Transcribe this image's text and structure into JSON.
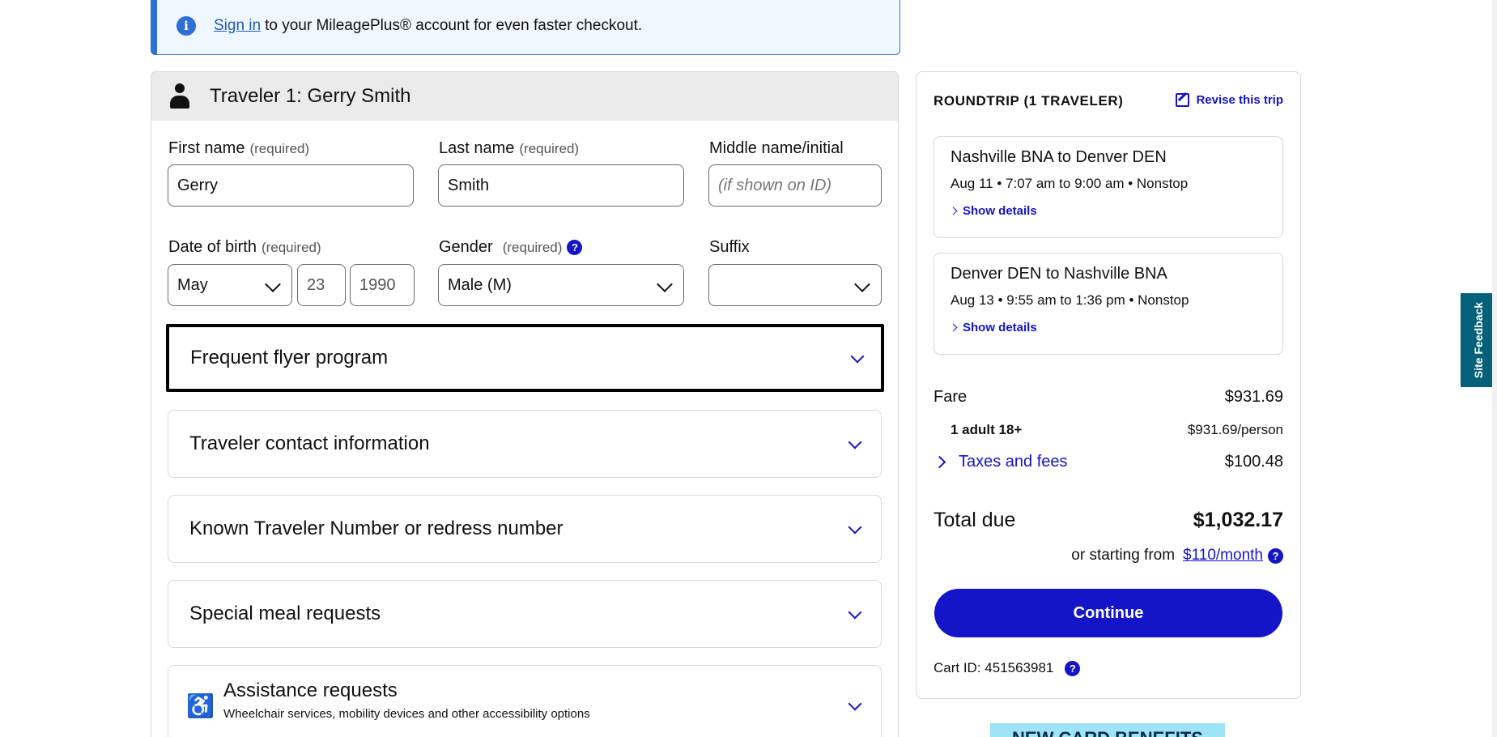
{
  "banner": {
    "info_icon": "i",
    "signin_link": "Sign in",
    "text": "to your MileagePlus® account for even faster checkout."
  },
  "traveler": {
    "heading": "Traveler 1: Gerry Smith",
    "first_name": {
      "label": "First name",
      "req": "(required)",
      "value": "Gerry"
    },
    "last_name": {
      "label": "Last name",
      "req": "(required)",
      "value": "Smith"
    },
    "middle_name": {
      "label": "Middle name/initial",
      "placeholder": "(if shown on ID)"
    },
    "dob": {
      "label": "Date of birth",
      "req": "(required)",
      "month": "May",
      "day": "23",
      "year": "1990"
    },
    "gender": {
      "label": "Gender",
      "req": "(required)",
      "value": "Male (M)"
    },
    "suffix": {
      "label": "Suffix",
      "value": ""
    },
    "help_glyph": "?"
  },
  "accordions": {
    "frequent_flyer": "Frequent flyer program",
    "contact": "Traveler contact information",
    "known_traveler": "Known Traveler Number or redress number",
    "meal": "Special meal requests",
    "assistance": "Assistance requests",
    "assistance_sub": "Wheelchair services, mobility devices and other accessibility options"
  },
  "summary": {
    "title": "ROUNDTRIP (1 TRAVELER)",
    "revise": "Revise this trip",
    "flights": [
      {
        "route": "Nashville BNA to Denver DEN",
        "times": "Aug 11 • 7:07 am to 9:00 am • Nonstop",
        "details": "Show details"
      },
      {
        "route": "Denver DEN to Nashville BNA",
        "times": "Aug 13 • 9:55 am to 1:36 pm • Nonstop",
        "details": "Show details"
      }
    ],
    "fare_label": "Fare",
    "fare_value": "$931.69",
    "adult_label": "1 adult 18+",
    "adult_value": "$931.69/person",
    "taxes_label": "Taxes and fees",
    "taxes_value": "$100.48",
    "total_label": "Total due",
    "total_value": "$1,032.17",
    "starting_from": "or starting from",
    "monthly": "$110/month",
    "continue": "Continue",
    "cart_id": "Cart ID: 451563981"
  },
  "promo_text": "NEW CARD BENEFITS",
  "feedback_tab": "Site Feedback",
  "colors": {
    "accent": "#1414c8",
    "banner_border": "#2f6fd6",
    "feedback_bg": "#05607a",
    "promo_bg": "#9ee4f4"
  }
}
